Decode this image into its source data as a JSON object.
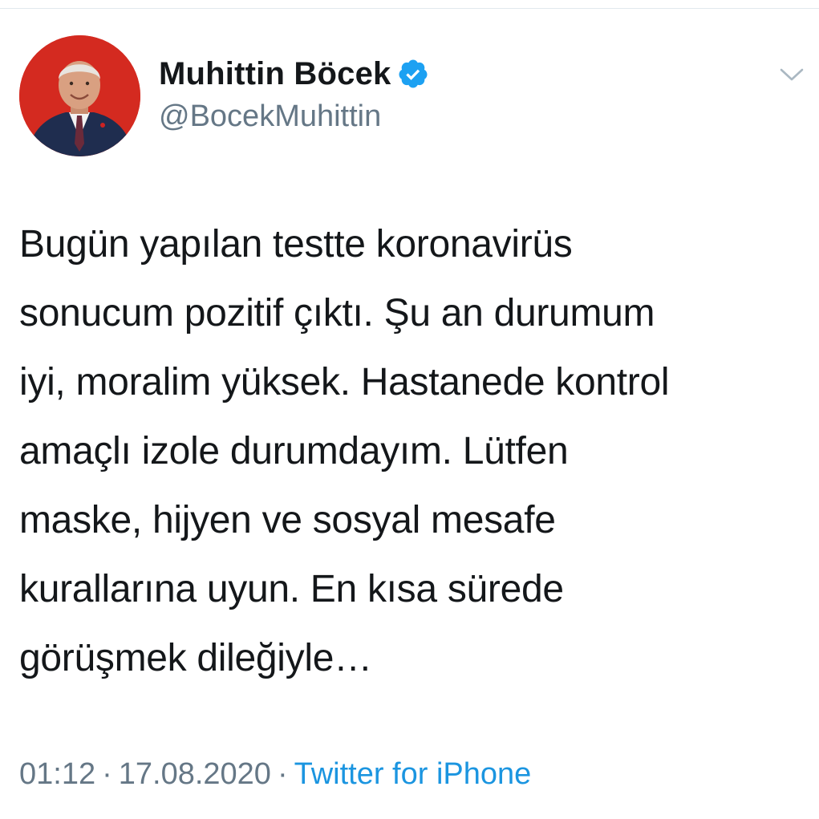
{
  "tweet": {
    "author": {
      "display_name": "Muhittin Böcek",
      "handle": "@BocekMuhittin",
      "verified_icon": "verified-badge-icon",
      "avatar_icon": "profile-photo"
    },
    "menu_icon": "chevron-down-icon",
    "text": "Bugün yapılan testte koronavirüs\nsonucum pozitif çıktı. Şu an durumum\niyi, moralim yüksek. Hastanede kontrol\namaçlı izole durumdayım. Lütfen\nmaske, hijyen ve sosyal mesafe\nkurallarına uyun. En kısa sürede\ngörüşmek dileğiyle…",
    "time": "01:12",
    "separator": "·",
    "date": "17.08.2020",
    "source": "Twitter for iPhone"
  },
  "colors": {
    "text_primary": "#14171a",
    "text_secondary": "#657786",
    "link": "#1b95e0",
    "verified_blue": "#1da1f2",
    "avatar_background": "#d42a20"
  }
}
